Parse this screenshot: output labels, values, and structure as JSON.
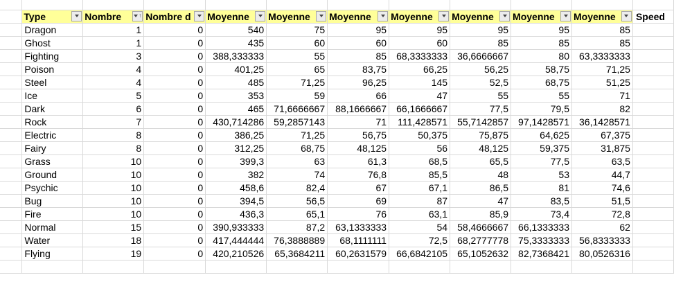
{
  "headers": [
    {
      "label": "Type",
      "filter": "dropdown"
    },
    {
      "label": "Nombre",
      "filter": "sorted"
    },
    {
      "label": "Nombre d",
      "filter": "dropdown"
    },
    {
      "label": "Moyenne",
      "filter": "dropdown"
    },
    {
      "label": "Moyenne",
      "filter": "dropdown"
    },
    {
      "label": "Moyenne",
      "filter": "dropdown"
    },
    {
      "label": "Moyenne",
      "filter": "dropdown"
    },
    {
      "label": "Moyenne",
      "filter": "dropdown"
    },
    {
      "label": "Moyenne",
      "filter": "dropdown"
    },
    {
      "label": "Moyenne",
      "filter": "dropdown"
    },
    {
      "label": "Speed",
      "filter": "none"
    }
  ],
  "rows": [
    [
      "Dragon",
      "1",
      "0",
      "540",
      "75",
      "95",
      "95",
      "95",
      "95",
      "85"
    ],
    [
      "Ghost",
      "1",
      "0",
      "435",
      "60",
      "60",
      "60",
      "85",
      "85",
      "85"
    ],
    [
      "Fighting",
      "3",
      "0",
      "388,333333",
      "55",
      "85",
      "68,3333333",
      "36,6666667",
      "80",
      "63,3333333"
    ],
    [
      "Poison",
      "4",
      "0",
      "401,25",
      "65",
      "83,75",
      "66,25",
      "56,25",
      "58,75",
      "71,25"
    ],
    [
      "Steel",
      "4",
      "0",
      "485",
      "71,25",
      "96,25",
      "145",
      "52,5",
      "68,75",
      "51,25"
    ],
    [
      "Ice",
      "5",
      "0",
      "353",
      "59",
      "66",
      "47",
      "55",
      "55",
      "71"
    ],
    [
      "Dark",
      "6",
      "0",
      "465",
      "71,6666667",
      "88,1666667",
      "66,1666667",
      "77,5",
      "79,5",
      "82"
    ],
    [
      "Rock",
      "7",
      "0",
      "430,714286",
      "59,2857143",
      "71",
      "111,428571",
      "55,7142857",
      "97,1428571",
      "36,1428571"
    ],
    [
      "Electric",
      "8",
      "0",
      "386,25",
      "71,25",
      "56,75",
      "50,375",
      "75,875",
      "64,625",
      "67,375"
    ],
    [
      "Fairy",
      "8",
      "0",
      "312,25",
      "68,75",
      "48,125",
      "56",
      "48,125",
      "59,375",
      "31,875"
    ],
    [
      "Grass",
      "10",
      "0",
      "399,3",
      "63",
      "61,3",
      "68,5",
      "65,5",
      "77,5",
      "63,5"
    ],
    [
      "Ground",
      "10",
      "0",
      "382",
      "74",
      "76,8",
      "85,5",
      "48",
      "53",
      "44,7"
    ],
    [
      "Psychic",
      "10",
      "0",
      "458,6",
      "82,4",
      "67",
      "67,1",
      "86,5",
      "81",
      "74,6"
    ],
    [
      "Bug",
      "10",
      "0",
      "394,5",
      "56,5",
      "69",
      "87",
      "47",
      "83,5",
      "51,5"
    ],
    [
      "Fire",
      "10",
      "0",
      "436,3",
      "65,1",
      "76",
      "63,1",
      "85,9",
      "73,4",
      "72,8"
    ],
    [
      "Normal",
      "15",
      "0",
      "390,933333",
      "87,2",
      "63,1333333",
      "54",
      "58,4666667",
      "66,1333333",
      "62"
    ],
    [
      "Water",
      "18",
      "0",
      "417,444444",
      "76,3888889",
      "68,1111111",
      "72,5",
      "68,2777778",
      "75,3333333",
      "56,8333333"
    ],
    [
      "Flying",
      "19",
      "0",
      "420,210526",
      "65,3684211",
      "60,2631579",
      "66,6842105",
      "65,1052632",
      "82,7368421",
      "80,0526316"
    ]
  ],
  "colors": {
    "header_fill": "#ffff99",
    "gridline": "#d9d9d9"
  }
}
